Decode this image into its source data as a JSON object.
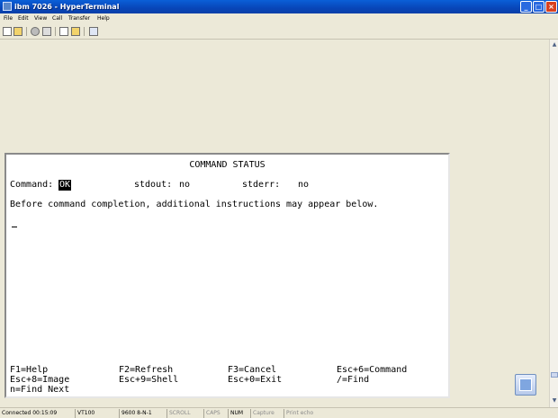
{
  "window": {
    "title": "ibm 7026 - HyperTerminal",
    "controls": {
      "minimize": "_",
      "maximize": "□",
      "close": "×"
    }
  },
  "menu": [
    "File",
    "Edit",
    "View",
    "Call",
    "Transfer",
    "Help"
  ],
  "toolbar": {
    "icons": [
      "new-icon",
      "open-icon",
      "disconnect-icon",
      "dial-icon",
      "send-icon",
      "receive-icon",
      "properties-icon"
    ]
  },
  "terminal": {
    "title": "COMMAND STATUS",
    "command_label": "Command:",
    "command_value": "OK",
    "stdout_label": "stdout:",
    "stdout_value": "no",
    "stderr_label": "stderr:",
    "stderr_value": "no",
    "message": "Before command completion, additional instructions may appear below.",
    "keys": [
      [
        "F1=Help",
        "F2=Refresh",
        "F3=Cancel",
        "Esc+6=Command"
      ],
      [
        "Esc+8=Image",
        "Esc+9=Shell",
        "Esc+0=Exit",
        "/=Find"
      ],
      [
        "n=Find Next",
        "",
        "",
        ""
      ]
    ]
  },
  "statusbar": {
    "connected": "Connected 00:15:09",
    "emulation": "VT100",
    "settings": "9600 8-N-1",
    "scroll": "SCROLL",
    "caps": "CAPS",
    "num": "NUM",
    "capture": "Capture",
    "printecho": "Print echo"
  },
  "scroll_icons": {
    "up": "▲",
    "down": "▼"
  }
}
